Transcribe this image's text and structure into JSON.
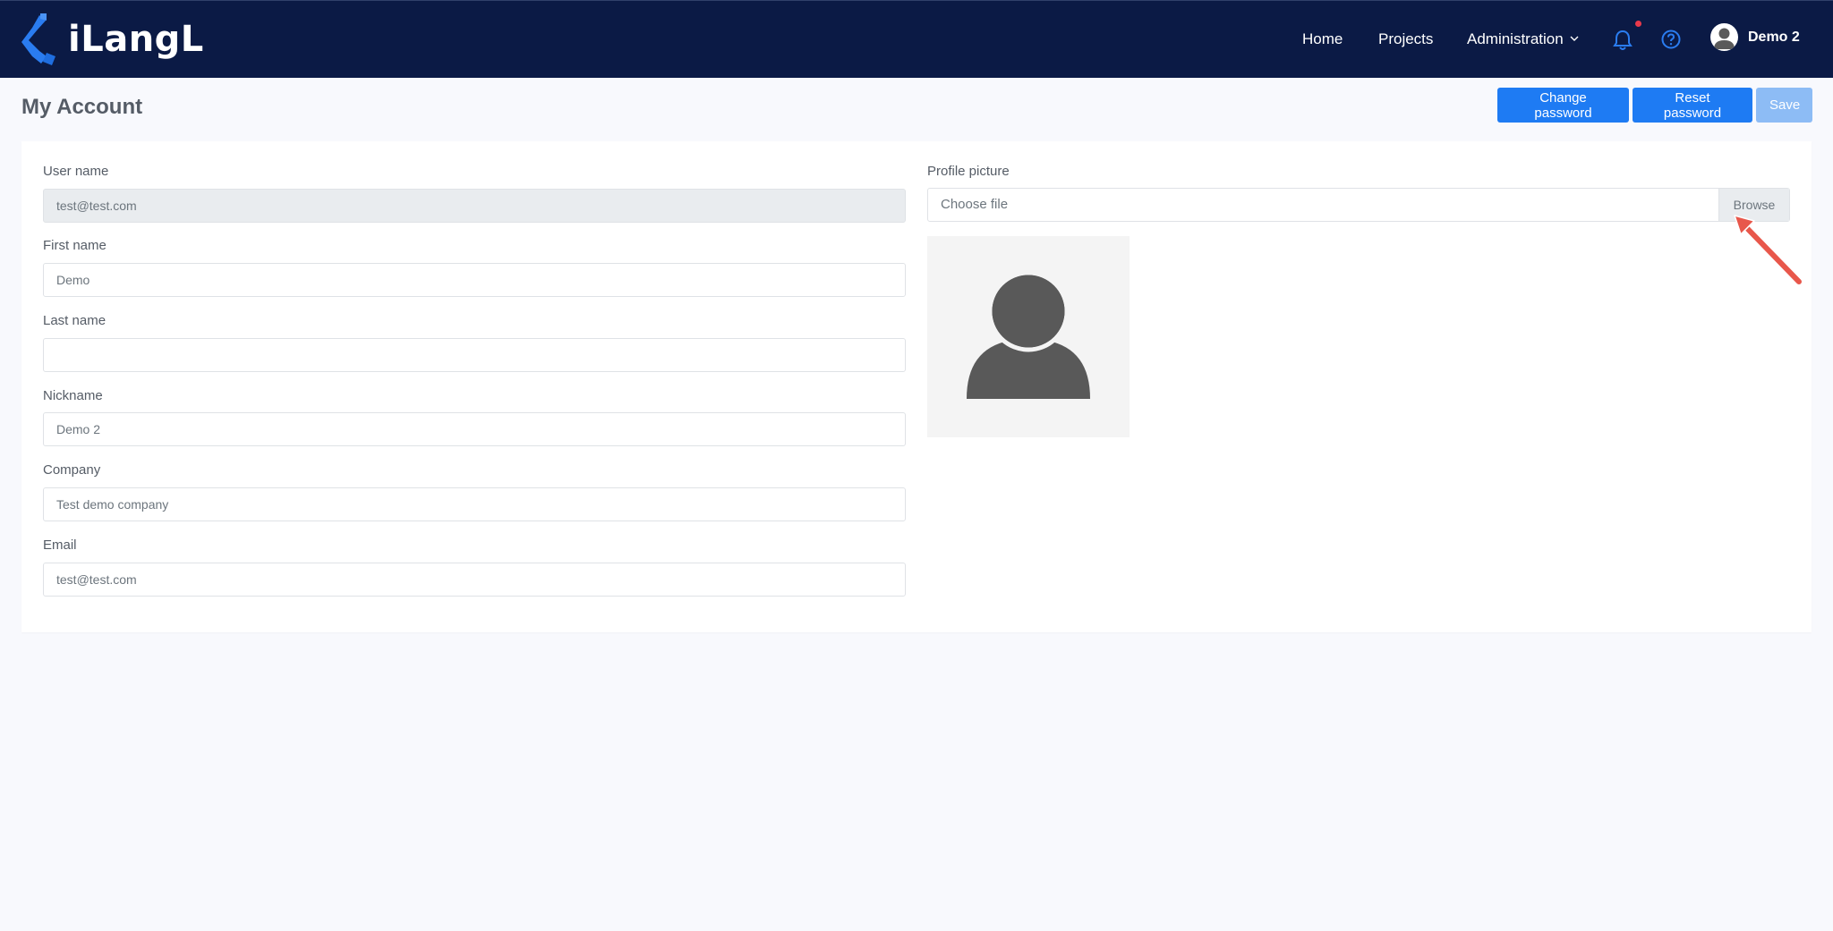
{
  "app": {
    "name": "iLangL",
    "brand_color": "#0b1a45",
    "accent_color": "#1e7bf3"
  },
  "nav": {
    "home": "Home",
    "projects": "Projects",
    "administration": "Administration",
    "user_name": "Demo 2",
    "icons": [
      "bell-icon",
      "help-icon",
      "avatar-icon",
      "chevron-down-icon"
    ]
  },
  "page": {
    "title": "My Account"
  },
  "actions": {
    "change_password": "Change password",
    "reset_password": "Reset password",
    "save": "Save"
  },
  "form": {
    "username": {
      "label": "User name",
      "value": "test@test.com"
    },
    "first_name": {
      "label": "First name",
      "value": "Demo"
    },
    "last_name": {
      "label": "Last name",
      "value": ""
    },
    "nickname": {
      "label": "Nickname",
      "value": "Demo 2"
    },
    "company": {
      "label": "Company",
      "value": "Test demo company"
    },
    "email": {
      "label": "Email",
      "value": "test@test.com"
    }
  },
  "profile_picture": {
    "label": "Profile picture",
    "placeholder": "Choose file",
    "browse": "Browse"
  }
}
